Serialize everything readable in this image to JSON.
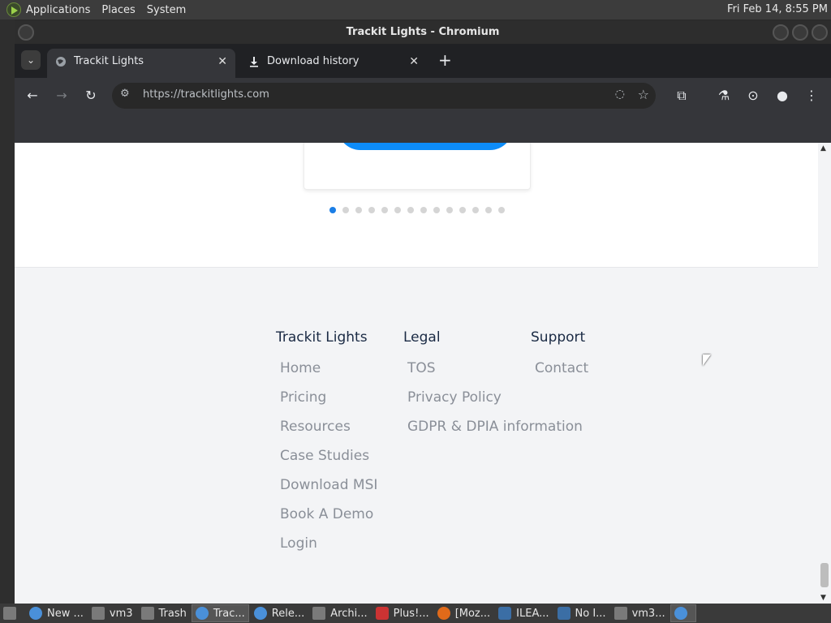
{
  "system_panel": {
    "menus": [
      "Applications",
      "Places",
      "System"
    ],
    "clock": "Fri Feb 14,  8:55 PM"
  },
  "window": {
    "title": "Trackit Lights - Chromium"
  },
  "tabs": [
    {
      "label": "Trackit Lights",
      "active": true,
      "icon": "globe-icon"
    },
    {
      "label": "Download history",
      "active": false,
      "icon": "download-icon"
    }
  ],
  "toolbar": {
    "url": "https://trackitlights.com"
  },
  "carousel": {
    "dot_count": 14,
    "active_index": 0,
    "accent": "#0d8cf8"
  },
  "footer": {
    "columns": [
      {
        "heading": "Trackit Lights",
        "links": [
          "Home",
          "Pricing",
          "Resources",
          "Case Studies",
          "Download MSI",
          "Book A Demo",
          "Login"
        ]
      },
      {
        "heading": "Legal",
        "links": [
          "TOS",
          "Privacy Policy",
          "GDPR & DPIA information"
        ]
      },
      {
        "heading": "Support",
        "links": [
          "Contact"
        ]
      }
    ]
  },
  "taskbar": {
    "items": [
      {
        "label": "New ...",
        "icon": "chromium-icon"
      },
      {
        "label": "vm3",
        "icon": "folder-icon"
      },
      {
        "label": "Trash",
        "icon": "trash-icon"
      },
      {
        "label": "Trac...",
        "icon": "chromium-icon",
        "active": true
      },
      {
        "label": "Rele...",
        "icon": "chromium-icon"
      },
      {
        "label": "Archi...",
        "icon": "archive-icon"
      },
      {
        "label": "Plus!...",
        "icon": "app-icon"
      },
      {
        "label": "[Moz...",
        "icon": "firefox-icon"
      },
      {
        "label": "ILEA...",
        "icon": "python-icon"
      },
      {
        "label": "No I...",
        "icon": "python-icon"
      },
      {
        "label": "vm3...",
        "icon": "terminal-icon"
      }
    ]
  }
}
